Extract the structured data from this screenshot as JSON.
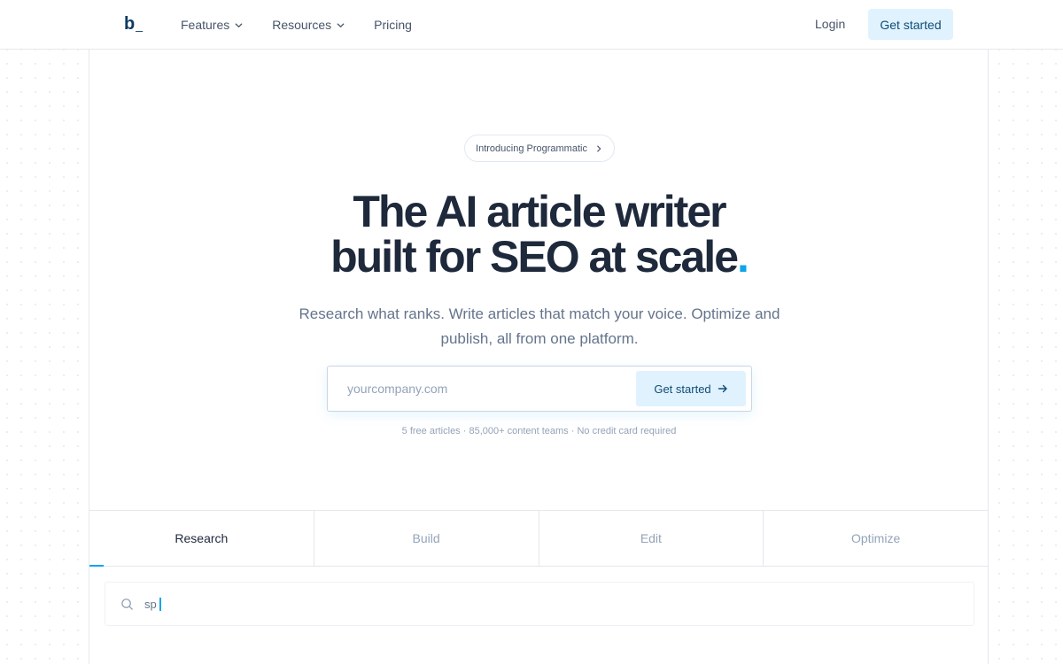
{
  "navbar": {
    "logo_letter": "b",
    "logo_suffix": "_",
    "items": [
      {
        "label": "Features",
        "has_dropdown": true
      },
      {
        "label": "Resources",
        "has_dropdown": true
      },
      {
        "label": "Pricing",
        "has_dropdown": false
      }
    ],
    "login_label": "Login",
    "cta_label": "Get started"
  },
  "hero": {
    "badge_label": "Introducing Programmatic",
    "headline_line1": "The AI article writer",
    "headline_line2": "built for SEO at scale",
    "headline_dot": ".",
    "subheadline": "Research what ranks. Write articles that match your voice. Optimize and publish, all from one platform.",
    "signup": {
      "placeholder": "yourcompany.com",
      "value": "",
      "button_label": "Get started"
    },
    "fine_print": "5 free articles · 85,000+ content teams · No credit card required"
  },
  "tabs": [
    {
      "label": "Research",
      "active": true
    },
    {
      "label": "Build",
      "active": false
    },
    {
      "label": "Edit",
      "active": false
    },
    {
      "label": "Optimize",
      "active": false
    }
  ],
  "tab_progress": 0.025,
  "demo_search": {
    "typed_text": "sp"
  },
  "colors": {
    "accent": "#0ea5e9",
    "cta_bg": "#e0f2fe",
    "cta_text": "#0f4c75",
    "heading": "#1e293b",
    "muted": "#64748b"
  },
  "icons": {
    "dropdown": "chevron-down-icon",
    "badge": "chevron-right-icon",
    "signup_button": "arrow-right-icon",
    "search": "search-icon"
  }
}
